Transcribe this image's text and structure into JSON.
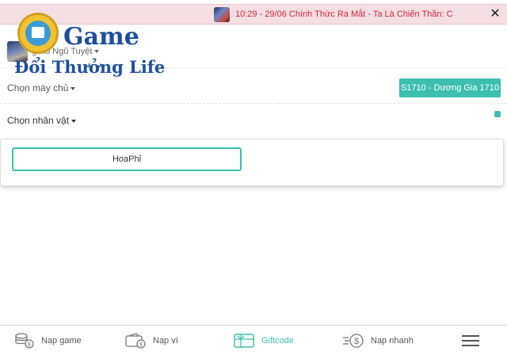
{
  "notice": {
    "thumbnail_icon": "game-thumbnail-icon",
    "text": "10:29 - 29/06 Chính Thức Ra Mắt - Ta Là Chiến Thần: C",
    "close_label": "✕",
    "text_color": "#d42a3f",
    "background": "#f3dee2"
  },
  "game": {
    "select_label": "g Hồ Ngũ Tuyệt"
  },
  "server": {
    "select_label": "Chọn máy chủ",
    "selected_server": "S1710 - Dương Gia 1710"
  },
  "character": {
    "select_label": "Chọn nhân vật",
    "options": [
      "HoaPhỉ"
    ]
  },
  "watermark": {
    "title": "Game",
    "subtitle": "Đổi Thưởng Life"
  },
  "bottom_nav": {
    "items": [
      {
        "icon": "coins-icon",
        "label": "Nạp game"
      },
      {
        "icon": "wallet-icon",
        "label": "Nạp ví"
      },
      {
        "icon": "giftcode-icon",
        "label": "Giftcode",
        "active": true
      },
      {
        "icon": "fast-pay-icon",
        "label": "Nạp nhanh"
      }
    ],
    "menu_icon": "hamburger-menu-icon"
  },
  "colors": {
    "accent": "#3dbfb0",
    "notice_red": "#d42a3f",
    "brand_blue": "#1d4f9c"
  }
}
